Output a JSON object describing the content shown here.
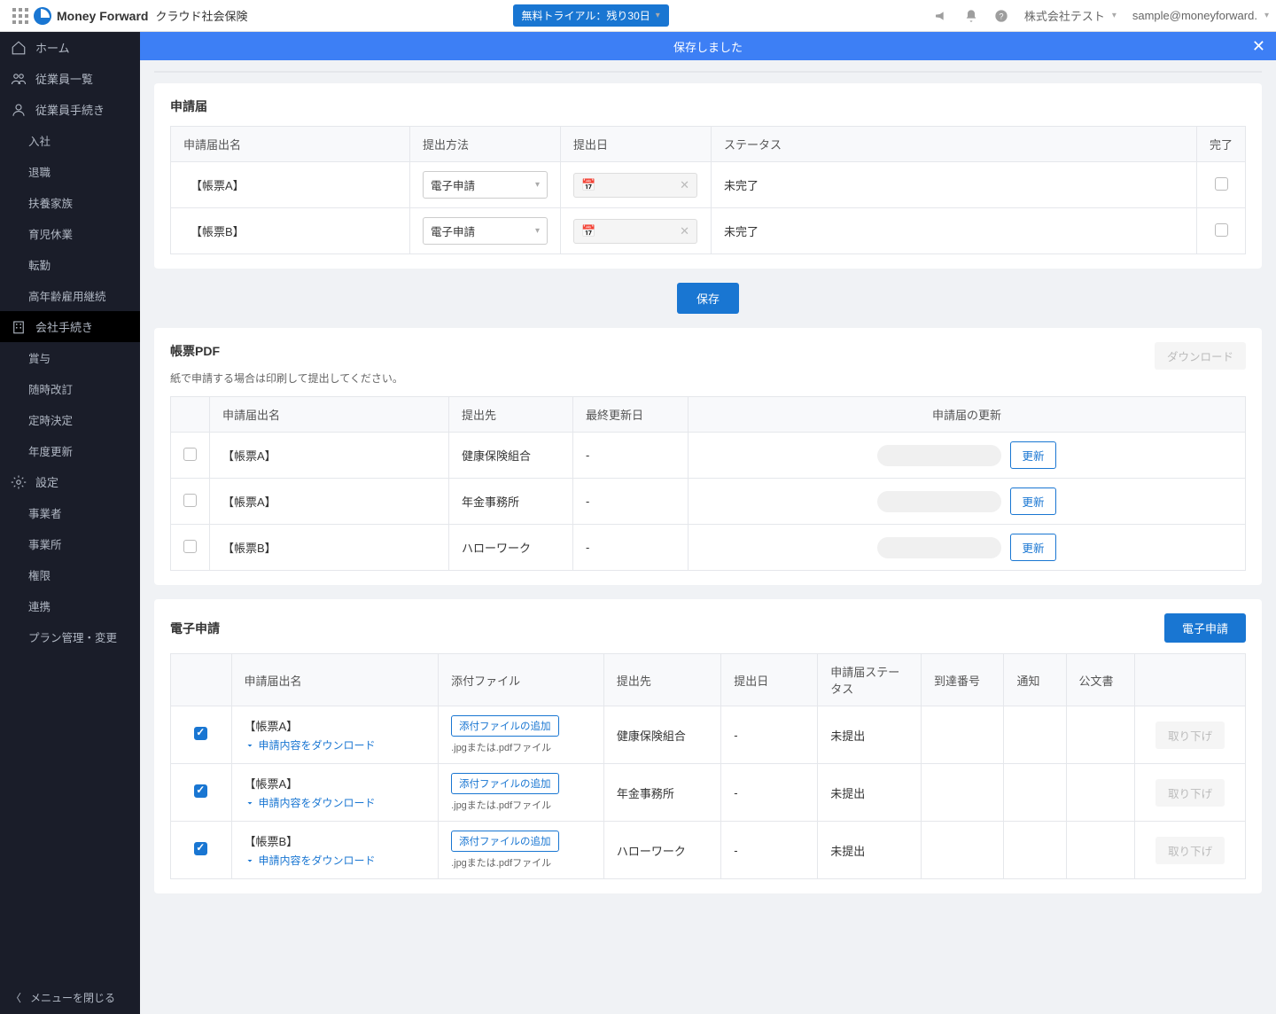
{
  "header": {
    "logo_main": "Money Forward",
    "logo_sub": "クラウド社会保険",
    "trial": "無料トライアル：残り30日",
    "company": "株式会社テスト",
    "user": "sample@moneyforward."
  },
  "notification": {
    "text": "保存しました"
  },
  "sidebar": {
    "home": "ホーム",
    "employees": "従業員一覧",
    "emp_proc": "従業員手続き",
    "emp_sub": [
      "入社",
      "退職",
      "扶養家族",
      "育児休業",
      "転勤",
      "高年齢雇用継続"
    ],
    "company_proc": "会社手続き",
    "company_sub": [
      "賞与",
      "随時改訂",
      "定時決定",
      "年度更新"
    ],
    "settings": "設定",
    "settings_sub": [
      "事業者",
      "事業所",
      "権限",
      "連携",
      "プラン管理・変更"
    ],
    "close": "メニューを閉じる"
  },
  "section1": {
    "title": "申請届",
    "headers": [
      "申請届出名",
      "提出方法",
      "提出日",
      "ステータス",
      "完了"
    ],
    "rows": [
      {
        "name": "【帳票A】",
        "method": "電子申請",
        "status": "未完了"
      },
      {
        "name": "【帳票B】",
        "method": "電子申請",
        "status": "未完了"
      }
    ],
    "save": "保存"
  },
  "section2": {
    "title": "帳票PDF",
    "sub": "紙で申請する場合は印刷して提出してください。",
    "download": "ダウンロード",
    "headers": [
      "申請届出名",
      "提出先",
      "最終更新日",
      "申請届の更新"
    ],
    "update": "更新",
    "rows": [
      {
        "name": "【帳票A】",
        "dest": "健康保険組合",
        "date": "-"
      },
      {
        "name": "【帳票A】",
        "dest": "年金事務所",
        "date": "-"
      },
      {
        "name": "【帳票B】",
        "dest": "ハローワーク",
        "date": "-"
      }
    ]
  },
  "section3": {
    "title": "電子申請",
    "apply": "電子申請",
    "headers": [
      "申請届出名",
      "添付ファイル",
      "提出先",
      "提出日",
      "申請届ステータス",
      "到達番号",
      "通知",
      "公文書",
      ""
    ],
    "attach": "添付ファイルの追加",
    "hint": ".jpgまたは.pdfファイル",
    "dl_link": "申請内容をダウンロード",
    "cancel": "取り下げ",
    "rows": [
      {
        "name": "【帳票A】",
        "dest": "健康保険組合",
        "date": "-",
        "status": "未提出"
      },
      {
        "name": "【帳票A】",
        "dest": "年金事務所",
        "date": "-",
        "status": "未提出"
      },
      {
        "name": "【帳票B】",
        "dest": "ハローワーク",
        "date": "-",
        "status": "未提出"
      }
    ]
  }
}
